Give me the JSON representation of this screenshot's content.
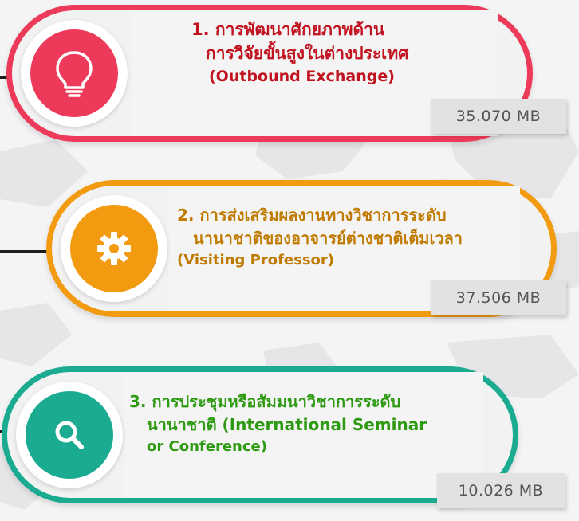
{
  "items": [
    {
      "title_line1": "1. การพัฒนาศักยภาพด้าน",
      "title_line2": "การวิจัยขั้นสูงในต่างประเทศ",
      "title_line3": "(Outbound Exchange)",
      "size": "35.070 MB",
      "icon": "lightbulb-icon",
      "color": "#ee3a5a",
      "text_color": "#c1121f"
    },
    {
      "title_line1": "2. การส่งเสริมผลงานทางวิชาการระดับ",
      "title_line2": "นานาชาติของอาจารย์ต่างชาติเต็มเวลา",
      "title_line3": "(Visiting Professor)",
      "size": "37.506 MB",
      "icon": "gear-icon",
      "color": "#f29a10",
      "text_color": "#c07a00"
    },
    {
      "title_line1": "3. การประชุมหรือสัมมนาวิชาการระดับ",
      "title_line2": "นานาชาติ (International Seminar",
      "title_line3": "or Conference)",
      "size": "10.026 MB",
      "icon": "magnifier-icon",
      "color": "#1aab90",
      "text_color": "#2d9a12"
    }
  ]
}
